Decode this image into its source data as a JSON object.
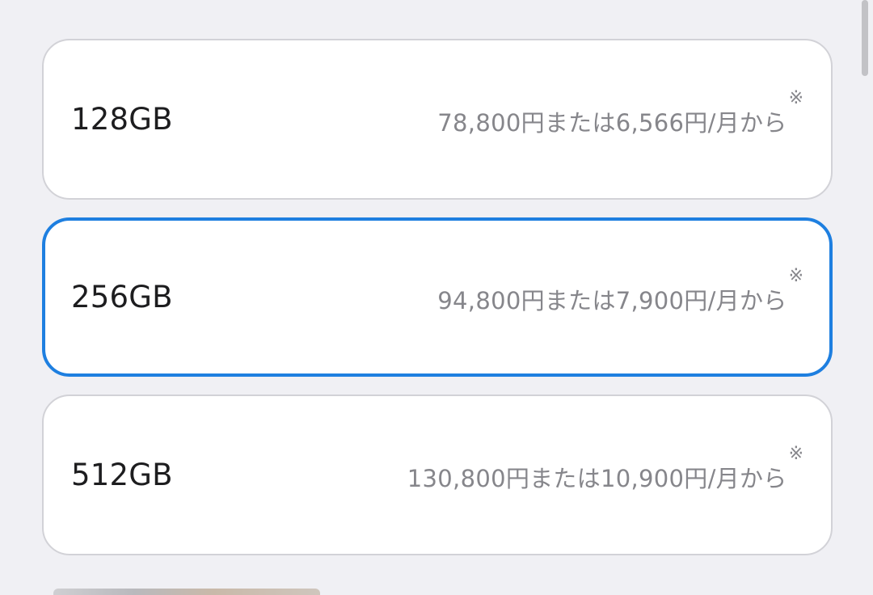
{
  "storage_options": [
    {
      "capacity": "128GB",
      "price": "78,800円または6,566円/月から",
      "footnote": "※",
      "selected": false
    },
    {
      "capacity": "256GB",
      "price": "94,800円または7,900円/月から",
      "footnote": "※",
      "selected": true
    },
    {
      "capacity": "512GB",
      "price": "130,800円または10,900円/月から",
      "footnote": "※",
      "selected": false
    }
  ],
  "colors": {
    "background": "#f0f0f4",
    "card": "#ffffff",
    "card_border": "#d2d2d7",
    "selected_border": "#1e7fe0",
    "capacity_text": "#1d1d1f",
    "price_text": "#86868b"
  }
}
